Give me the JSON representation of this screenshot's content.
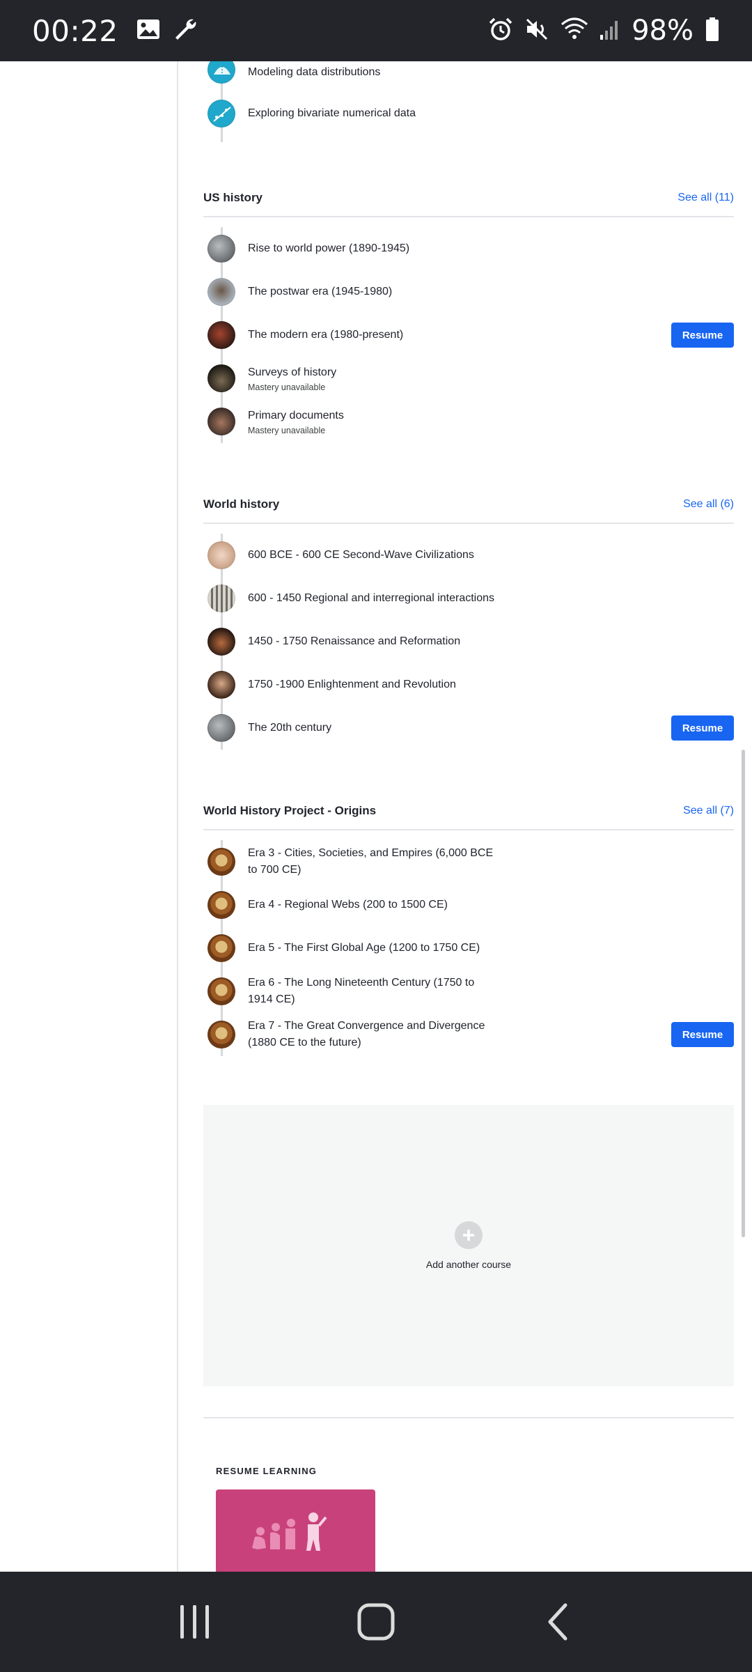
{
  "status_bar": {
    "time": "00:22",
    "battery": "98%"
  },
  "top_units": [
    {
      "title": "Modeling data distributions",
      "icon": "math-distribution-icon"
    },
    {
      "title": "Exploring bivariate numerical data",
      "icon": "math-scatter-icon"
    }
  ],
  "sections": [
    {
      "title": "US history",
      "see_all": "See all (11)",
      "units": [
        {
          "title": "Rise to world power (1890-1945)",
          "subtitle": ""
        },
        {
          "title": "The postwar era (1945-1980)",
          "subtitle": ""
        },
        {
          "title": "The modern era (1980-present)",
          "subtitle": "",
          "resume": "Resume"
        },
        {
          "title": "Surveys of history",
          "subtitle": "Mastery unavailable"
        },
        {
          "title": "Primary documents",
          "subtitle": "Mastery unavailable"
        }
      ]
    },
    {
      "title": "World history",
      "see_all": "See all (6)",
      "units": [
        {
          "title": "600 BCE - 600 CE Second-Wave Civilizations",
          "subtitle": ""
        },
        {
          "title": "600 - 1450 Regional and interregional interactions",
          "subtitle": ""
        },
        {
          "title": "1450 - 1750 Renaissance and Reformation",
          "subtitle": ""
        },
        {
          "title": "1750 -1900 Enlightenment and Revolution",
          "subtitle": ""
        },
        {
          "title": "The 20th century",
          "subtitle": "",
          "resume": "Resume"
        }
      ]
    },
    {
      "title": "World History Project - Origins",
      "see_all": "See all (7)",
      "units": [
        {
          "title": "Era 3 - Cities, Societies, and Empires (6,000 BCE to 700 CE)",
          "subtitle": ""
        },
        {
          "title": "Era 4 - Regional Webs (200 to 1500 CE)",
          "subtitle": ""
        },
        {
          "title": "Era 5 - The First Global Age (1200 to 1750 CE)",
          "subtitle": ""
        },
        {
          "title": "Era 6 - The Long Nineteenth Century (1750 to 1914 CE)",
          "subtitle": ""
        },
        {
          "title": "Era 7 - The Great Convergence and Divergence (1880 CE to the future)",
          "subtitle": "",
          "resume": "Resume"
        }
      ]
    }
  ],
  "add_course": {
    "label": "Add another course"
  },
  "resume_learning": {
    "heading": "RESUME LEARNING"
  },
  "colors": {
    "accent": "#1865f2",
    "math_teal": "#1fa8cb",
    "card_pink": "#c9417b",
    "system_bar": "#23252a"
  }
}
